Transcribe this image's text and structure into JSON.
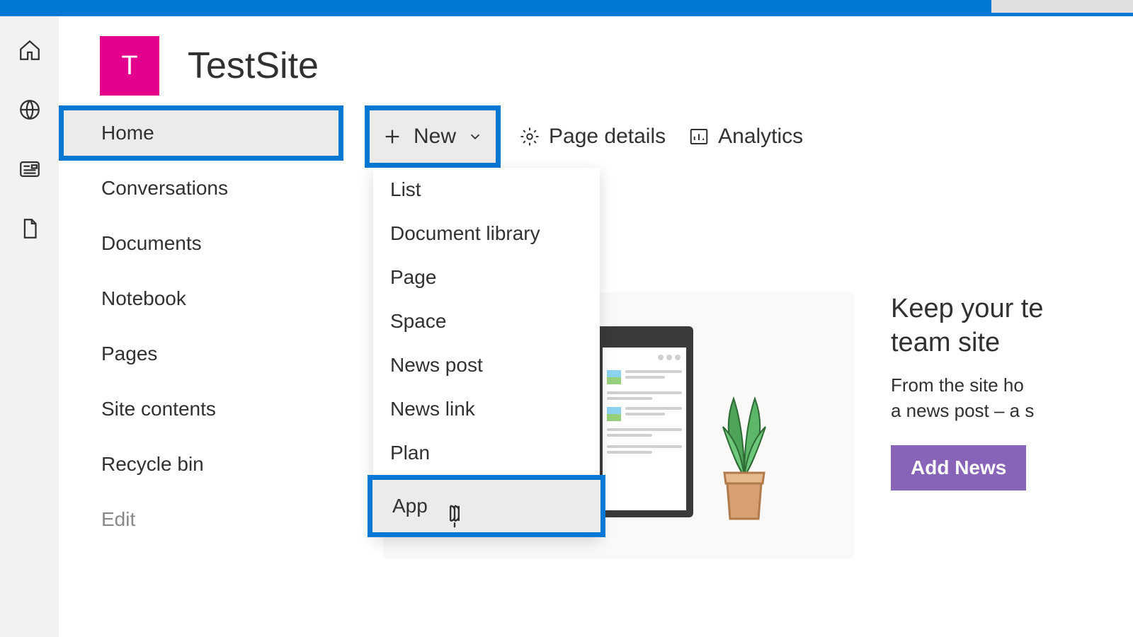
{
  "site": {
    "logo_letter": "T",
    "title": "TestSite"
  },
  "nav": {
    "items": [
      "Home",
      "Conversations",
      "Documents",
      "Notebook",
      "Pages",
      "Site contents",
      "Recycle bin"
    ],
    "edit_label": "Edit"
  },
  "toolbar": {
    "new_label": "New",
    "page_details_label": "Page details",
    "analytics_label": "Analytics"
  },
  "new_menu": {
    "items": [
      "List",
      "Document library",
      "Page",
      "Space",
      "News post",
      "News link",
      "Plan",
      "App"
    ]
  },
  "news_panel": {
    "title_line1": "Keep your te",
    "title_line2": "team site",
    "body_line1": "From the site ho",
    "body_line2": "a news post – a s",
    "button_label": "Add News"
  }
}
